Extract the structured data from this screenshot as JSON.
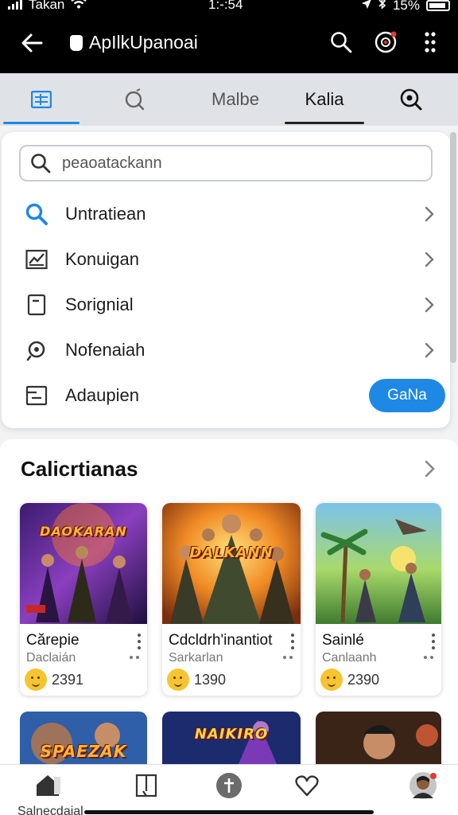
{
  "status": {
    "carrier": "Takan",
    "time": "1:-:54",
    "battery": "15%"
  },
  "app": {
    "title": "ApIlkUpanoai"
  },
  "icons": {
    "back": "back-arrow-icon",
    "search": "search-icon",
    "record": "record-icon",
    "more": "more-vert-icon"
  },
  "tabs": [
    {
      "label": "",
      "icon": "list-icon"
    },
    {
      "label": "",
      "icon": "search-icon"
    },
    {
      "label": "Malbe"
    },
    {
      "label": "Kalia"
    },
    {
      "label": "",
      "icon": "zoom-icon"
    }
  ],
  "search": {
    "placeholder": "peaoatackann"
  },
  "menu": [
    {
      "label": "Untratiean",
      "icon": "search-icon"
    },
    {
      "label": "Konuigan",
      "icon": "chart-icon"
    },
    {
      "label": "Sorignial",
      "icon": "document-icon"
    },
    {
      "label": "Nofenaiah",
      "icon": "location-icon"
    },
    {
      "label": "Adaupien",
      "icon": "window-icon",
      "action": "GaNa"
    }
  ],
  "section": {
    "title": "Calicrtianas"
  },
  "games": [
    {
      "title": "Cărepie",
      "subtitle": "Daclaián",
      "count": "2391",
      "art_text": "DAOKARAN",
      "art_color": "#5a2a8a"
    },
    {
      "title": "Cdcldrh'inantiot",
      "subtitle": "Sarkarlan",
      "count": "1390",
      "art_text": "DALKANN",
      "art_color": "#e08a22"
    },
    {
      "title": "Sainlé",
      "subtitle": "Canlaanh",
      "count": "2390",
      "art_text": "",
      "art_color": "#3f9a4a"
    }
  ],
  "previews": [
    {
      "art_text": "SPAEZAK"
    },
    {
      "art_text": "NAIKIRO"
    },
    {
      "art_text": ""
    }
  ],
  "bottom_nav": {
    "first_label": "Salnecdaial"
  }
}
